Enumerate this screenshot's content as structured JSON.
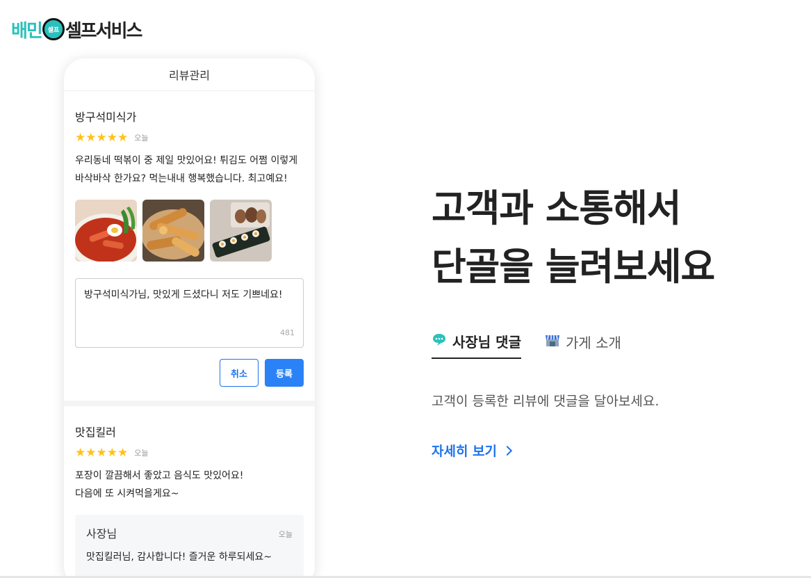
{
  "logo": {
    "part_a": "배민",
    "badge": "셀프",
    "part_b": "셀프서비스"
  },
  "phone": {
    "header": "리뷰관리",
    "review1": {
      "reviewer": "방구석미식가",
      "stars": "★★★★★",
      "rating": 5,
      "date": "오늘",
      "text": "우리동네 떡볶이 중 제일 맛있어요! 튀김도 어쩜 이렇게\n바삭바삭 한가요? 먹는내내 행복했습니다. 최고예요!",
      "photos": [
        "tteokbokki-photo",
        "fried-food-photo",
        "gimbap-photo"
      ],
      "reply_value": "방구석미식가님, 맛있게 드셨다니 저도 기쁘네요!",
      "char_count": "481",
      "cancel_label": "취소",
      "submit_label": "등록"
    },
    "review2": {
      "reviewer": "맛집킬러",
      "stars": "★★★★★",
      "rating": 5,
      "date": "오늘",
      "text": "포장이 깔끔해서 좋았고 음식도 맛있어요!\n다음에 또 시켜먹을게요~",
      "owner_reply": {
        "name": "사장님",
        "date": "오늘",
        "text": "맛집킬러님, 감사합니다! 즐거운 하루되세요~"
      }
    }
  },
  "headline": {
    "line1": "고객과 소통해서",
    "line2": "단골을 늘려보세요"
  },
  "tabs": [
    {
      "label": "사장님 댓글",
      "icon": "speech-bubble-icon",
      "active": true
    },
    {
      "label": "가게 소개",
      "icon": "store-icon",
      "active": false
    }
  ],
  "description": "고객이 등록한 리뷰에 댓글을 달아보세요.",
  "more_link": "자세히 보기",
  "colors": {
    "brand_mint": "#2ac1bc",
    "accent_blue": "#1c73ed",
    "star": "#ffc21a"
  }
}
